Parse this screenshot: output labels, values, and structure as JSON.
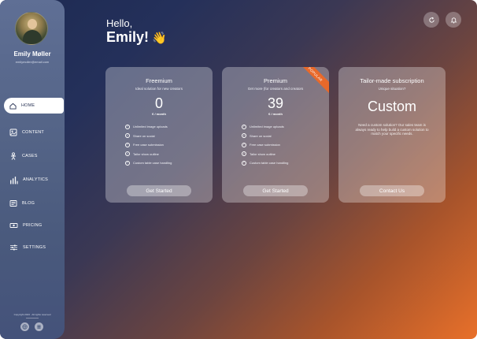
{
  "user": {
    "name": "Emily Møller",
    "email": "emilymoller@email.com"
  },
  "greeting": {
    "hello": "Hello,",
    "name": "Emily!",
    "emoji": "👋"
  },
  "nav": [
    {
      "label": "HOME",
      "icon": "home-icon",
      "active": true
    },
    {
      "label": "CONTENT",
      "icon": "image-icon",
      "active": false
    },
    {
      "label": "CASES",
      "icon": "person-icon",
      "active": false
    },
    {
      "label": "ANALYTICS",
      "icon": "bar-chart-icon",
      "active": false
    },
    {
      "label": "BLOG",
      "icon": "newspaper-icon",
      "active": false
    },
    {
      "label": "PRICING",
      "icon": "money-icon",
      "active": false
    },
    {
      "label": "SETTINGS",
      "icon": "sliders-icon",
      "active": false
    }
  ],
  "footer": {
    "copyright": "Copyright 2023 · All rights reserved"
  },
  "plans": [
    {
      "title": "Freemium",
      "subtitle": "Ideal solution for new creators",
      "price": "0",
      "period": "€ / month",
      "features": [
        "Unlimited image uploads",
        "Share on social",
        "Free case submission",
        "Tailor show outline",
        "Custom table case handling"
      ],
      "button": "Get Started"
    },
    {
      "title": "Premium",
      "subtitle": "Get more (for creators and creators",
      "price": "39",
      "period": "€ / month",
      "badge": "POPULAR",
      "features": [
        "Unlimited image uploads",
        "Share on social",
        "Free case submission",
        "Tailor show outline",
        "Custom table case handling"
      ],
      "button": "Get Started"
    },
    {
      "title": "Tailor-made subscription",
      "subtitle": "Unique situation?",
      "price": "Custom",
      "description": "Need a custom solution? Our sales team is always ready to help build a custom solution to match your specific needs.",
      "button": "Contact Us"
    }
  ],
  "colors": {
    "accent": "#e8692a",
    "sidebar": "#546487",
    "bg_start": "#1d2a52",
    "bg_end": "#e8702a"
  }
}
